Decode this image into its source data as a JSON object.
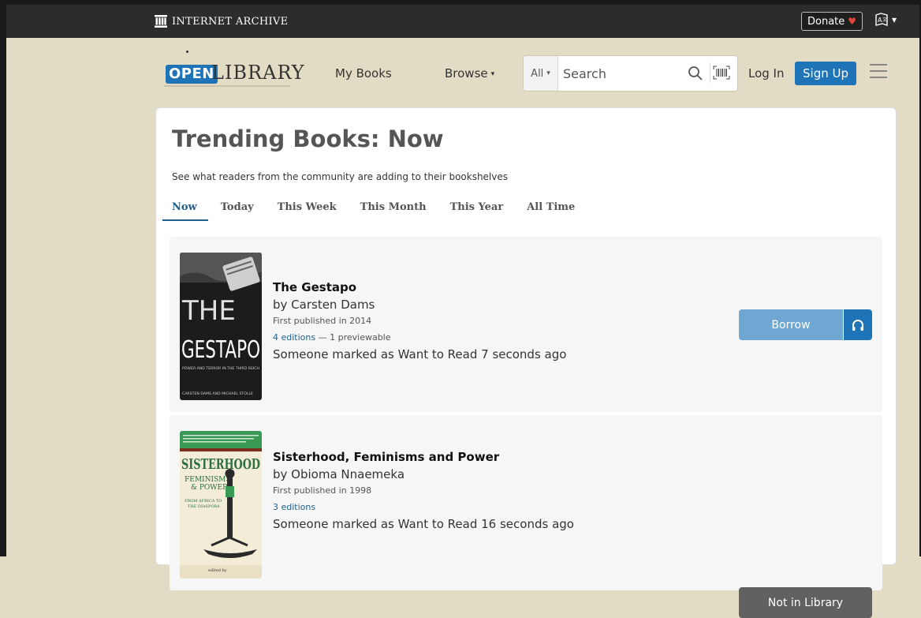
{
  "ia_bar": {
    "logo_text": "INTERNET ARCHIVE",
    "donate_label": "Donate",
    "donate_heart": "♥",
    "lang_caret": "▾"
  },
  "header": {
    "logo_open": "OPEN",
    "logo_library": "LIBRARY",
    "nav_my_books": "My Books",
    "nav_browse": "Browse",
    "caret": "▾",
    "search_scope": "All",
    "search_placeholder": "Search",
    "login_label": "Log In",
    "signup_label": "Sign Up"
  },
  "page": {
    "title": "Trending Books: Now",
    "subtitle": "See what readers from the community are adding to their bookshelves",
    "tabs": [
      {
        "label": "Now",
        "active": true
      },
      {
        "label": "Today"
      },
      {
        "label": "This Week"
      },
      {
        "label": "This Month"
      },
      {
        "label": "This Year"
      },
      {
        "label": "All Time"
      }
    ]
  },
  "books": [
    {
      "title": "The Gestapo",
      "author": "by Carsten Dams",
      "first_published": "First published in 2014",
      "editions_link": "4 editions",
      "editions_extra": " — 1 previewable",
      "activity": "Someone marked as Want to Read 7 seconds ago",
      "action_label": "Borrow",
      "cover": {
        "line1": "THE",
        "line2": "GESTAPO",
        "tagline": "POWER AND TERROR IN THE THIRD REICH",
        "authors": "CARSTEN DAMS AND MICHAEL STOLLE"
      }
    },
    {
      "title": "Sisterhood, Feminisms and Power",
      "author": "by Obioma Nnaemeka",
      "first_published": "First published in 1998",
      "editions_link": "3 editions",
      "activity": "Someone marked as Want to Read 16 seconds ago",
      "action_label": "Not in Library",
      "cover": {
        "line1": "SISTERHOOD",
        "line2": "FEMINISMS",
        "line3": "& POWER",
        "line4": "FROM AFRICA TO",
        "line5": "THE DIASPORA",
        "editor": "edited by"
      }
    }
  ],
  "colors": {
    "background": "#e2dcc5",
    "brand_blue": "#1f74b8",
    "link_blue": "#1f5f8b",
    "borrow_light": "#6fa7d3",
    "not_in_library": "#616161"
  }
}
